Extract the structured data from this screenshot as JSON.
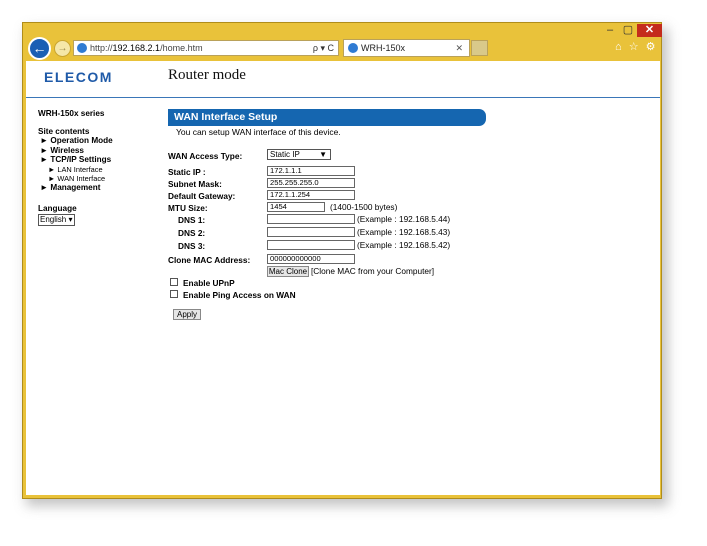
{
  "browser": {
    "address_prefix": "http://",
    "address_host": "192.168.2.1",
    "address_path": "/home.htm",
    "address_tools": "ρ ▾ C",
    "tab_title": "WRH-150x",
    "window_controls": {
      "minimize": "–",
      "maximize": "▢",
      "close": "✕"
    },
    "toolbar_icons": "⌂ ☆ ⚙"
  },
  "header": {
    "logo": "ELECOM",
    "mode_title": "Router mode"
  },
  "sidebar": {
    "series": "WRH-150x series",
    "site_contents": "Site contents",
    "items": [
      {
        "label": "► Operation Mode"
      },
      {
        "label": "► Wireless"
      },
      {
        "label": "► TCP/IP Settings"
      },
      {
        "label": "► LAN Interface"
      },
      {
        "label": "► WAN Interface"
      },
      {
        "label": "► Management"
      }
    ],
    "language_label": "Language",
    "language_value": "English"
  },
  "main": {
    "title": "WAN Interface Setup",
    "description": "You can setup WAN interface of this device.",
    "access_type_label": "WAN Access Type:",
    "access_type_value": "Static IP",
    "static_ip_label": "Static IP :",
    "static_ip_value": "172.1.1.1",
    "subnet_label": "Subnet Mask:",
    "subnet_value": "255.255.255.0",
    "gateway_label": "Default Gateway:",
    "gateway_value": "172.1.1.254",
    "mtu_label": "MTU Size:",
    "mtu_value": "1454",
    "mtu_note": "(1400-1500 bytes)",
    "dns1_label": "DNS 1:",
    "dns1_value": "",
    "dns1_note": "(Example : 192.168.5.44)",
    "dns2_label": "DNS 2:",
    "dns2_value": "",
    "dns2_note": "(Example : 192.168.5.43)",
    "dns3_label": "DNS 3:",
    "dns3_value": "",
    "dns3_note": "(Example : 192.168.5.42)",
    "clone_mac_label": "Clone MAC Address:",
    "clone_mac_value": "000000000000",
    "mac_clone_button": "Mac Clone",
    "mac_clone_note": "[Clone MAC from your Computer]",
    "upnp_label": "Enable UPnP",
    "ping_label": "Enable Ping Access on WAN",
    "apply_button": "Apply"
  },
  "colors": {
    "window_frame": "#e9c23a",
    "brand_blue": "#1f5aa8",
    "banner_blue": "#1566b0",
    "close_red": "#c42b1c"
  }
}
